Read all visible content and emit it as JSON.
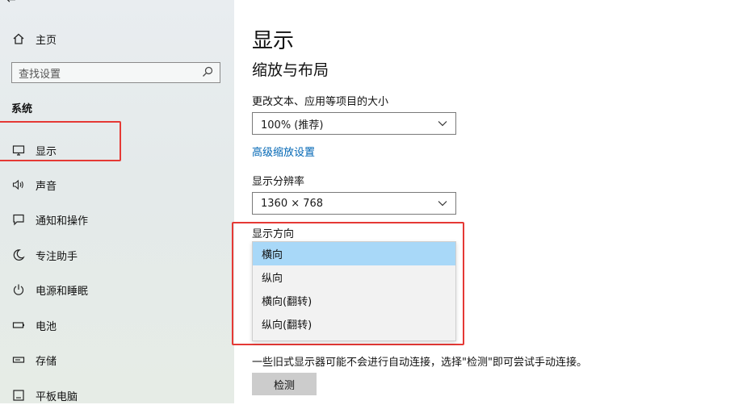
{
  "sidebar": {
    "home_label": "主页",
    "search_placeholder": "查找设置",
    "section_label": "系统",
    "items": [
      {
        "label": "显示",
        "icon": "monitor-icon"
      },
      {
        "label": "声音",
        "icon": "speaker-icon"
      },
      {
        "label": "通知和操作",
        "icon": "notification-icon"
      },
      {
        "label": "专注助手",
        "icon": "moon-icon"
      },
      {
        "label": "电源和睡眠",
        "icon": "power-icon"
      },
      {
        "label": "电池",
        "icon": "battery-icon"
      },
      {
        "label": "存储",
        "icon": "storage-icon"
      },
      {
        "label": "平板电脑",
        "icon": "tablet-icon"
      }
    ]
  },
  "main": {
    "title": "显示",
    "section_title": "缩放与布局",
    "scale": {
      "label": "更改文本、应用等项目的大小",
      "value": "100% (推荐)"
    },
    "advanced_scaling_link": "高级缩放设置",
    "resolution": {
      "label": "显示分辨率",
      "value": "1360 × 768"
    },
    "orientation": {
      "label": "显示方向",
      "options": [
        "横向",
        "纵向",
        "横向(翻转)",
        "纵向(翻转)"
      ],
      "selected": "横向"
    },
    "detect_description": "一些旧式显示器可能不会进行自动连接，选择\"检测\"即可尝试手动连接。",
    "detect_button": "检测"
  },
  "colors": {
    "accent_link": "#0066b4",
    "highlight_box": "#e53935",
    "selected_option": "#a8d8f8"
  }
}
